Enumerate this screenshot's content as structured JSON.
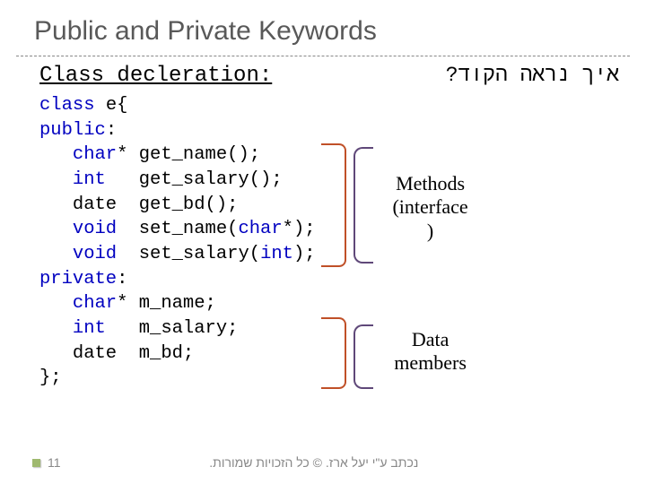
{
  "title": "Public and Private Keywords",
  "subheading": "Class decleration:",
  "hebrew_question": "איך נראה הקוד?",
  "code": {
    "l1a": "class",
    "l1b": " e{",
    "l2a": "public",
    "l2b": ":",
    "l3a": "   ",
    "l3b": "char",
    "l3c": "* get_name();",
    "l4a": "   ",
    "l4b": "int",
    "l4c": "   get_salary();",
    "l5a": "   date  get_bd();",
    "l6a": "   ",
    "l6b": "void",
    "l6c": "  set_name(",
    "l6d": "char",
    "l6e": "*);",
    "l7a": "   ",
    "l7b": "void",
    "l7c": "  set_salary(",
    "l7d": "int",
    "l7e": ");",
    "l8a": "private",
    "l8b": ":",
    "l9a": "   ",
    "l9b": "char",
    "l9c": "* m_name;",
    "l10a": "   ",
    "l10b": "int",
    "l10c": "   m_salary;",
    "l11a": "   date  m_bd;",
    "l12a": "};"
  },
  "labels": {
    "methods": "Methods\n(interface\n)",
    "data": "Data\nmembers"
  },
  "footer": {
    "page": "11",
    "copyright": "נכתב ע\"י יעל ארז. © כל הזכויות שמורות."
  }
}
